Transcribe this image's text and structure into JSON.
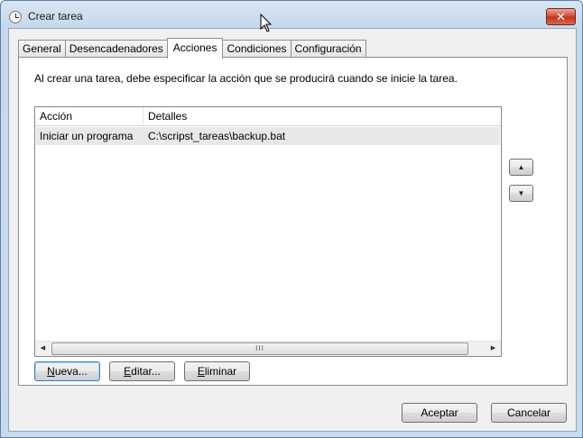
{
  "window": {
    "title": "Crear tarea",
    "close_label": "✕"
  },
  "tabs": [
    {
      "label": "General",
      "active": false
    },
    {
      "label": "Desencadenadores",
      "active": false
    },
    {
      "label": "Acciones",
      "active": true
    },
    {
      "label": "Condiciones",
      "active": false
    },
    {
      "label": "Configuración",
      "active": false
    }
  ],
  "panel": {
    "description": "Al crear una tarea, debe especificar la acción que se producirá cuando se inicie la tarea."
  },
  "actions_table": {
    "columns": [
      "Acción",
      "Detalles"
    ],
    "rows": [
      {
        "action": "Iniciar un programa",
        "details": "C:\\scripst_tareas\\backup.bat"
      }
    ]
  },
  "buttons": {
    "new": {
      "mnemonic": "N",
      "rest": "ueva..."
    },
    "edit": {
      "pre": "",
      "mnemonic": "E",
      "rest": "ditar..."
    },
    "delete": {
      "mnemonic": "E",
      "rest": "liminar"
    },
    "accept": "Aceptar",
    "cancel": "Cancelar"
  },
  "icons": {
    "move_up": "▲",
    "move_down": "▼",
    "scroll_left": "◀",
    "scroll_right": "▶",
    "thumb_grip": "III"
  }
}
